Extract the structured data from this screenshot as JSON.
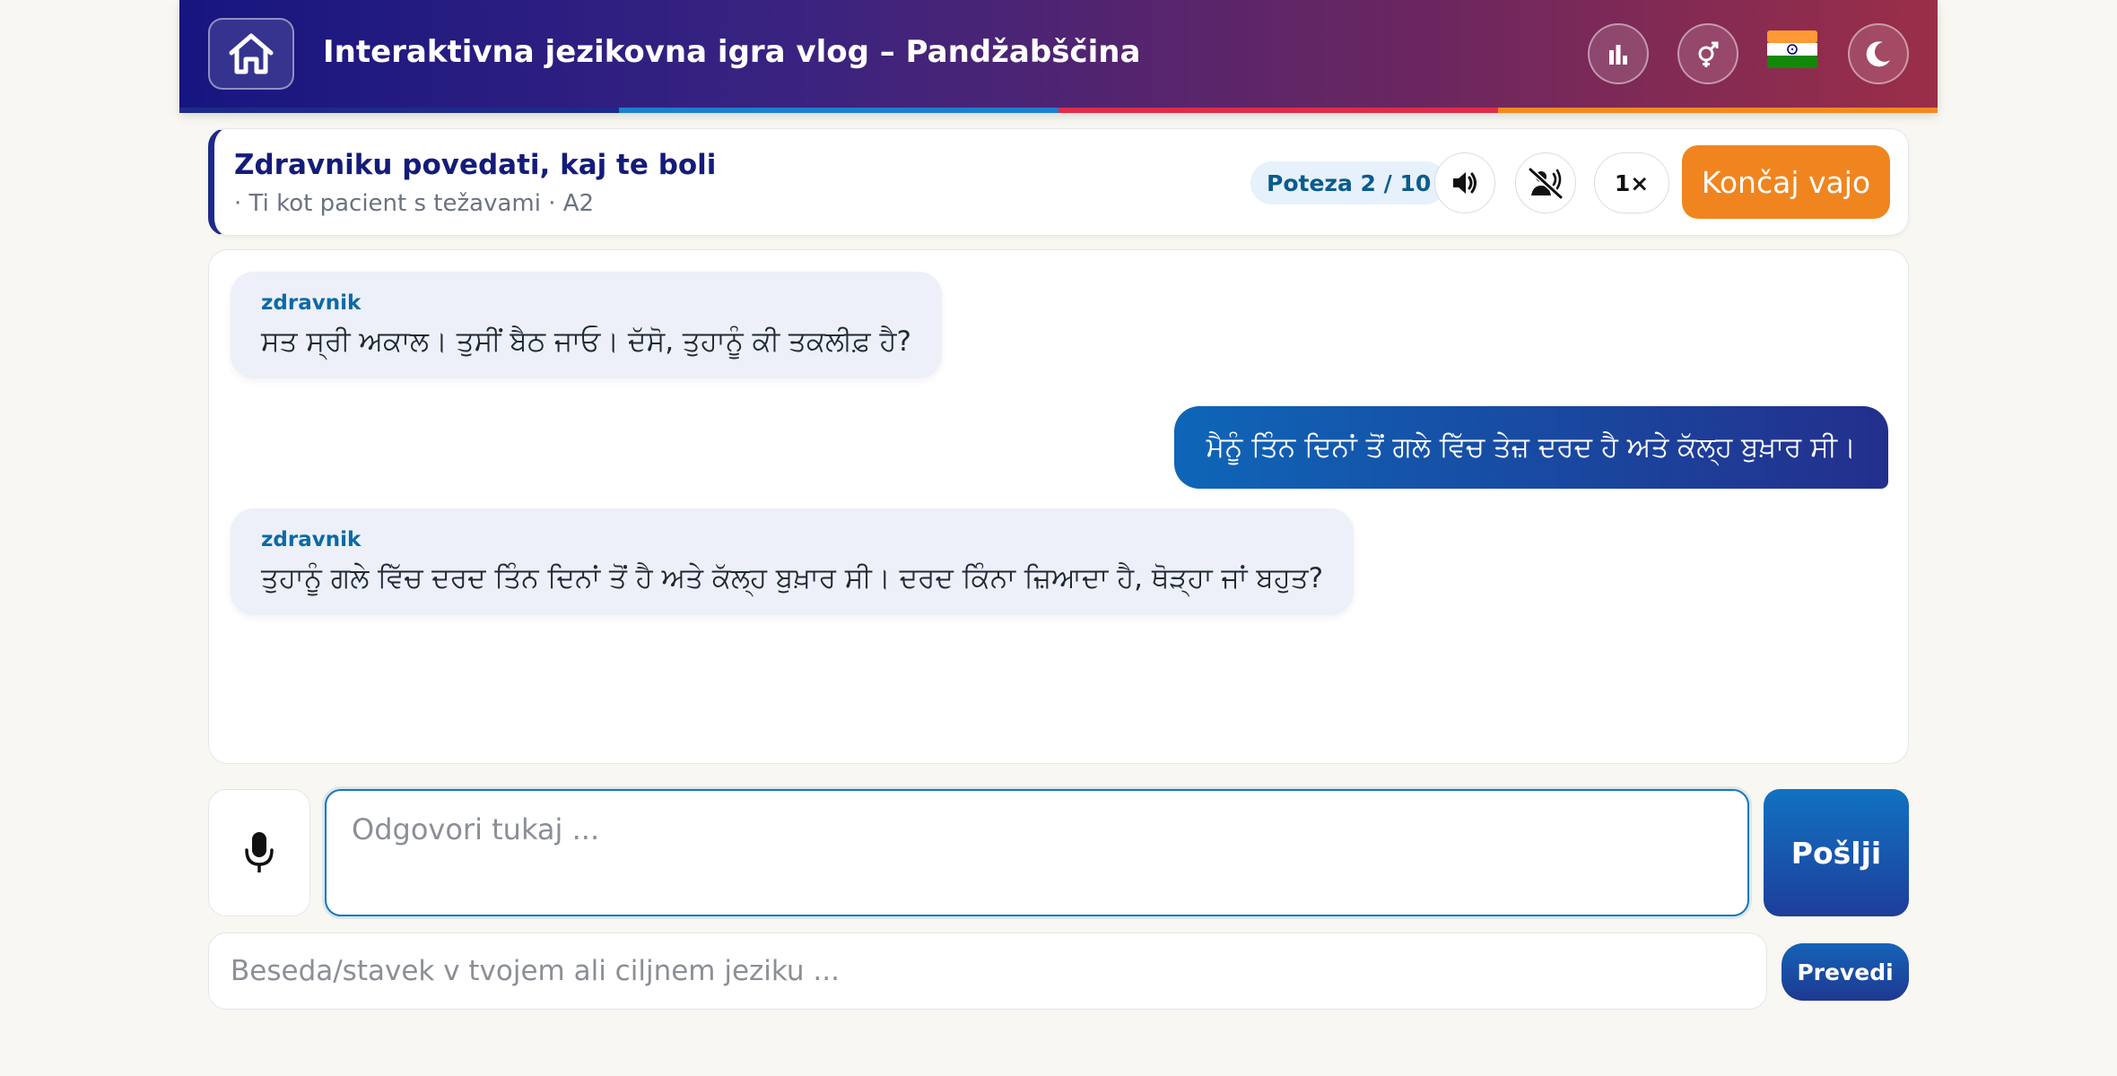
{
  "header": {
    "title": "Interaktivna jezikovna igra vlog – Pandžabščina",
    "icons": {
      "home": "home-icon",
      "stats": "bar-chart-icon",
      "gender": "gender-icon",
      "language_flag": "india-flag-icon",
      "theme": "moon-icon"
    },
    "stripe_colors": [
      "#1e2a8a",
      "#1b7fd0",
      "#e02b4a",
      "#f28a1e"
    ]
  },
  "scenario": {
    "title": "Zdravniku povedati, kaj te boli",
    "subtitle": "· Ti kot pacient s težavami · A2",
    "turn_label": "Poteza 2 / 10",
    "speed_label": "1×",
    "end_label": "Končaj vajo",
    "icons": {
      "sound": "speaker-icon",
      "mute_voice": "voice-off-icon"
    }
  },
  "chat": {
    "messages": [
      {
        "role": "in",
        "speaker": "zdravnik",
        "text": "ਸਤ ਸ੍ਰੀ ਅਕਾਲ। ਤੁਸੀਂ ਬੈਠ ਜਾਓ। ਦੱਸੋ, ਤੁਹਾਨੂੰ ਕੀ ਤਕਲੀਫ਼ ਹੈ?"
      },
      {
        "role": "out",
        "text": "ਮੈਨੂੰ ਤਿੰਨ ਦਿਨਾਂ ਤੋਂ ਗਲੇ ਵਿੱਚ ਤੇਜ਼ ਦਰਦ ਹੈ ਅਤੇ ਕੱਲ੍ਹ ਬੁਖ਼ਾਰ ਸੀ।"
      },
      {
        "role": "in",
        "speaker": "zdravnik",
        "text": "ਤੁਹਾਨੂੰ ਗਲੇ ਵਿੱਚ ਦਰਦ ਤਿੰਨ ਦਿਨਾਂ ਤੋਂ ਹੈ ਅਤੇ ਕੱਲ੍ਹ ਬੁਖ਼ਾਰ ਸੀ। ਦਰਦ ਕਿੰਨਾ ਜ਼ਿਆਦਾ ਹੈ, ਥੋੜ੍ਹਾ ਜਾਂ ਬਹੁਤ?"
      }
    ]
  },
  "composer": {
    "mic_icon": "microphone-icon",
    "answer_placeholder": "Odgovori tukaj ...",
    "send_label": "Pošlji",
    "translate_placeholder": "Beseda/stavek v tvojem ali ciljnem jeziku ...",
    "translate_label": "Prevedi"
  }
}
